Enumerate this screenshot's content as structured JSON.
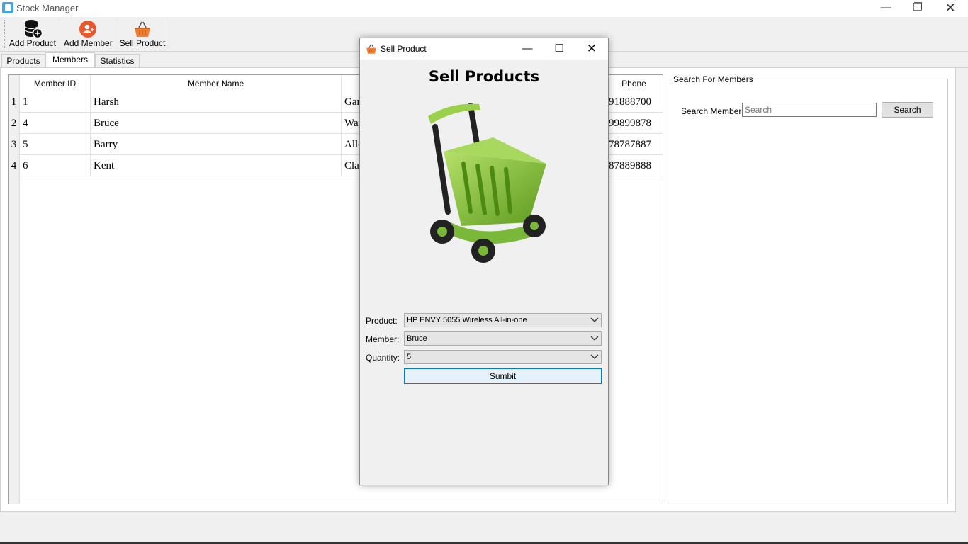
{
  "app": {
    "title": "Stock Manager"
  },
  "toolbar": {
    "add_product": "Add Product",
    "add_member": "Add Member",
    "sell_product": "Sell Product"
  },
  "tabs": [
    {
      "label": "Products"
    },
    {
      "label": "Members"
    },
    {
      "label": "Statistics"
    }
  ],
  "table": {
    "headers": [
      "Member ID",
      "Member Name",
      "",
      "Phone"
    ],
    "rows": [
      {
        "n": "1",
        "id": "1",
        "name": "Harsh",
        "col3": "Gan",
        "phone": "91888700"
      },
      {
        "n": "2",
        "id": "4",
        "name": "Bruce",
        "col3": "Way",
        "phone": "99899878"
      },
      {
        "n": "3",
        "id": "5",
        "name": "Barry",
        "col3": "Alle",
        "phone": "78787887"
      },
      {
        "n": "4",
        "id": "6",
        "name": "Kent",
        "col3": "Clar",
        "phone": "87889888"
      }
    ]
  },
  "search": {
    "group_title": "Search For Members",
    "label": "Search Members",
    "placeholder": "Search",
    "button": "Search"
  },
  "dialog": {
    "title": "Sell Product",
    "heading": "Sell Products",
    "product_label": "Product:",
    "product_value": "HP ENVY 5055 Wireless All-in-one",
    "member_label": "Member:",
    "member_value": "Bruce",
    "quantity_label": "Quantity:",
    "quantity_value": "5",
    "submit": "Sumbit"
  },
  "colors": {
    "accent": "#0078d7",
    "cart_green": "#8cc63f",
    "basket_orange": "#f08030"
  }
}
